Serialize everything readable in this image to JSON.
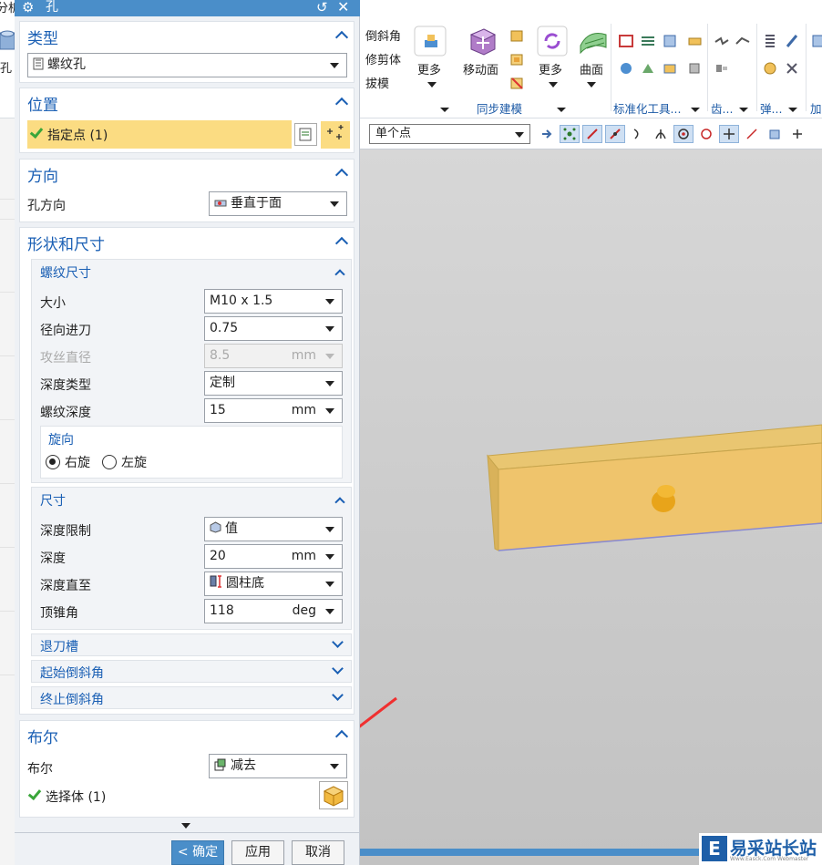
{
  "window": {
    "title": "孔"
  },
  "ribbon": {
    "left_fragments": {
      "top": "分析",
      "bottom": "孔",
      "sel_filter": "仅"
    },
    "col1": [
      "倒斜角",
      "修剪体",
      "拔模"
    ],
    "more1": "更多",
    "anim_face": "移动面",
    "more2": "更多",
    "surface": "曲面",
    "groups": {
      "sync": "同步建模",
      "std": "标准化工具...",
      "gear": "齿...",
      "spring": "弹...",
      "add": "加"
    },
    "selection_filter": "单个点"
  },
  "dialog": {
    "type": {
      "header": "类型",
      "value": "螺纹孔"
    },
    "position": {
      "header": "位置",
      "label": "指定点 (1)"
    },
    "direction": {
      "header": "方向",
      "label": "孔方向",
      "value": "垂直于面"
    },
    "shape": {
      "header": "形状和尺寸",
      "thread": {
        "header": "螺纹尺寸",
        "rows": {
          "size": {
            "label": "大小",
            "value": "M10 x 1.5"
          },
          "radial": {
            "label": "径向进刀",
            "value": "0.75"
          },
          "tap": {
            "label": "攻丝直径",
            "value": "8.5",
            "unit": "mm"
          },
          "depth_type": {
            "label": "深度类型",
            "value": "定制"
          },
          "thread_depth": {
            "label": "螺纹深度",
            "value": "15",
            "unit": "mm"
          }
        },
        "rotation": {
          "header": "旋向",
          "right": "右旋",
          "left": "左旋",
          "selected": "right"
        }
      },
      "dims": {
        "header": "尺寸",
        "rows": {
          "limit": {
            "label": "深度限制",
            "value": "值"
          },
          "depth": {
            "label": "深度",
            "value": "20",
            "unit": "mm"
          },
          "depth_to": {
            "label": "深度直至",
            "value": "圆柱底"
          },
          "tip": {
            "label": "顶锥角",
            "value": "118",
            "unit": "deg"
          }
        }
      },
      "collapsed": [
        "退刀槽",
        "起始倒斜角",
        "终止倒斜角"
      ]
    },
    "boolean": {
      "header": "布尔",
      "label": "布尔",
      "value": "减去",
      "select_body": "选择体 (1)"
    },
    "buttons": {
      "ok": "< 确定 >",
      "apply": "应用",
      "cancel": "取消"
    }
  },
  "watermark": {
    "text": "易采站长站",
    "sub": "Www.Easck.Com Webmaster"
  },
  "colors": {
    "title_bar": "#4a8ec9",
    "section_header": "#1a5fb4",
    "highlight": "#fbdc82",
    "body": "#f1c15a",
    "arrow": "#f03030"
  }
}
